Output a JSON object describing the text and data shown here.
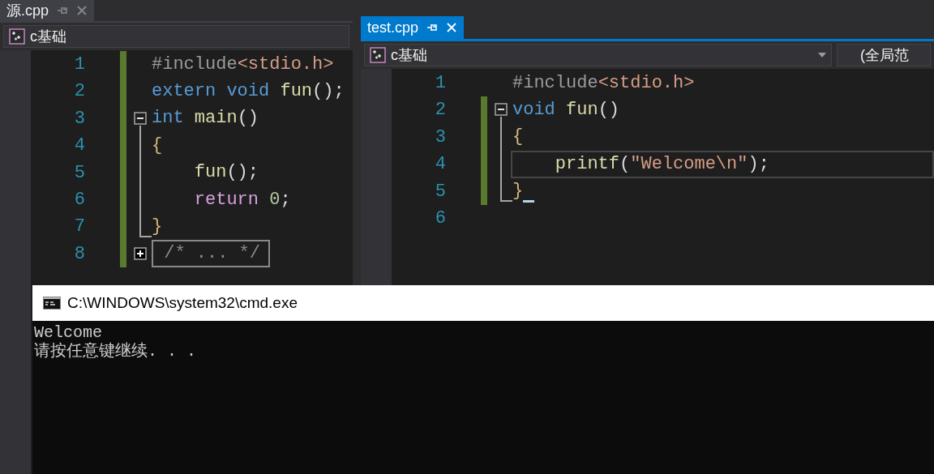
{
  "panes": [
    {
      "tab": {
        "label": "源.cpp",
        "selected": false
      },
      "dropdowns": [
        {
          "label": "c基础",
          "kind": "project",
          "caret": false
        }
      ],
      "lines": [
        {
          "number": "1",
          "kind": "plain",
          "changed": true,
          "current": false,
          "cursor": false,
          "tokens": [
            {
              "kind": "preprocessor",
              "text": "#include"
            },
            {
              "kind": "string",
              "text": "<stdio.h>"
            }
          ]
        },
        {
          "number": "2",
          "kind": "plain",
          "changed": true,
          "current": false,
          "cursor": false,
          "tokens": [
            {
              "kind": "keyword",
              "text": "extern void"
            },
            {
              "kind": "function",
              "text": " fun"
            },
            {
              "kind": "plain",
              "text": "();"
            }
          ]
        },
        {
          "number": "3",
          "kind": "fold-start",
          "changed": true,
          "current": false,
          "cursor": false,
          "tokens": [
            {
              "kind": "keyword",
              "text": "int"
            },
            {
              "kind": "function",
              "text": " main"
            },
            {
              "kind": "plain",
              "text": "()"
            }
          ]
        },
        {
          "number": "4",
          "kind": "block",
          "changed": true,
          "current": false,
          "cursor": false,
          "tokens": [
            {
              "kind": "brace",
              "text": "{"
            }
          ]
        },
        {
          "number": "5",
          "kind": "block",
          "changed": true,
          "current": false,
          "cursor": false,
          "tokens": [
            {
              "kind": "function",
              "text": "    fun"
            },
            {
              "kind": "plain",
              "text": "();"
            }
          ]
        },
        {
          "number": "6",
          "kind": "block",
          "changed": true,
          "current": false,
          "cursor": false,
          "tokens": [
            {
              "kind": "control",
              "text": "    return"
            },
            {
              "kind": "number",
              "text": " 0"
            },
            {
              "kind": "plain",
              "text": ";"
            }
          ]
        },
        {
          "number": "7",
          "kind": "block-end",
          "changed": true,
          "current": false,
          "cursor": false,
          "tokens": [
            {
              "kind": "brace",
              "text": "}"
            }
          ]
        },
        {
          "number": "8",
          "kind": "folded",
          "changed": true,
          "current": false,
          "cursor": false,
          "tokens": [
            {
              "kind": "collapsed",
              "text": " /* ... */"
            }
          ]
        }
      ]
    },
    {
      "tab": {
        "label": "test.cpp",
        "selected": true
      },
      "dropdowns": [
        {
          "label": "c基础",
          "kind": "project",
          "caret": true
        },
        {
          "label": "(全局范",
          "kind": "scope",
          "caret": false
        }
      ],
      "lines": [
        {
          "number": "1",
          "kind": "plain",
          "changed": false,
          "current": false,
          "cursor": false,
          "tokens": [
            {
              "kind": "preprocessor",
              "text": "#include"
            },
            {
              "kind": "string",
              "text": "<stdio.h>"
            }
          ]
        },
        {
          "number": "2",
          "kind": "fold-start",
          "changed": true,
          "current": false,
          "cursor": false,
          "tokens": [
            {
              "kind": "keyword",
              "text": "void"
            },
            {
              "kind": "function",
              "text": " fun"
            },
            {
              "kind": "plain",
              "text": "()"
            }
          ]
        },
        {
          "number": "3",
          "kind": "block",
          "changed": true,
          "current": false,
          "cursor": false,
          "tokens": [
            {
              "kind": "brace",
              "text": "{"
            }
          ]
        },
        {
          "number": "4",
          "kind": "block",
          "changed": true,
          "current": true,
          "cursor": false,
          "tokens": [
            {
              "kind": "function",
              "text": "    printf"
            },
            {
              "kind": "plain",
              "text": "("
            },
            {
              "kind": "string",
              "text": "\"Welcome\\n\""
            },
            {
              "kind": "plain",
              "text": ");"
            }
          ]
        },
        {
          "number": "5",
          "kind": "block-end",
          "changed": true,
          "current": false,
          "cursor": true,
          "tokens": [
            {
              "kind": "brace",
              "text": "}"
            }
          ]
        },
        {
          "number": "6",
          "kind": "plain",
          "changed": false,
          "current": false,
          "cursor": false
        }
      ]
    }
  ],
  "console": {
    "title": "C:\\WINDOWS\\system32\\cmd.exe",
    "output": [
      "Welcome",
      "请按任意键继续. . ."
    ]
  }
}
